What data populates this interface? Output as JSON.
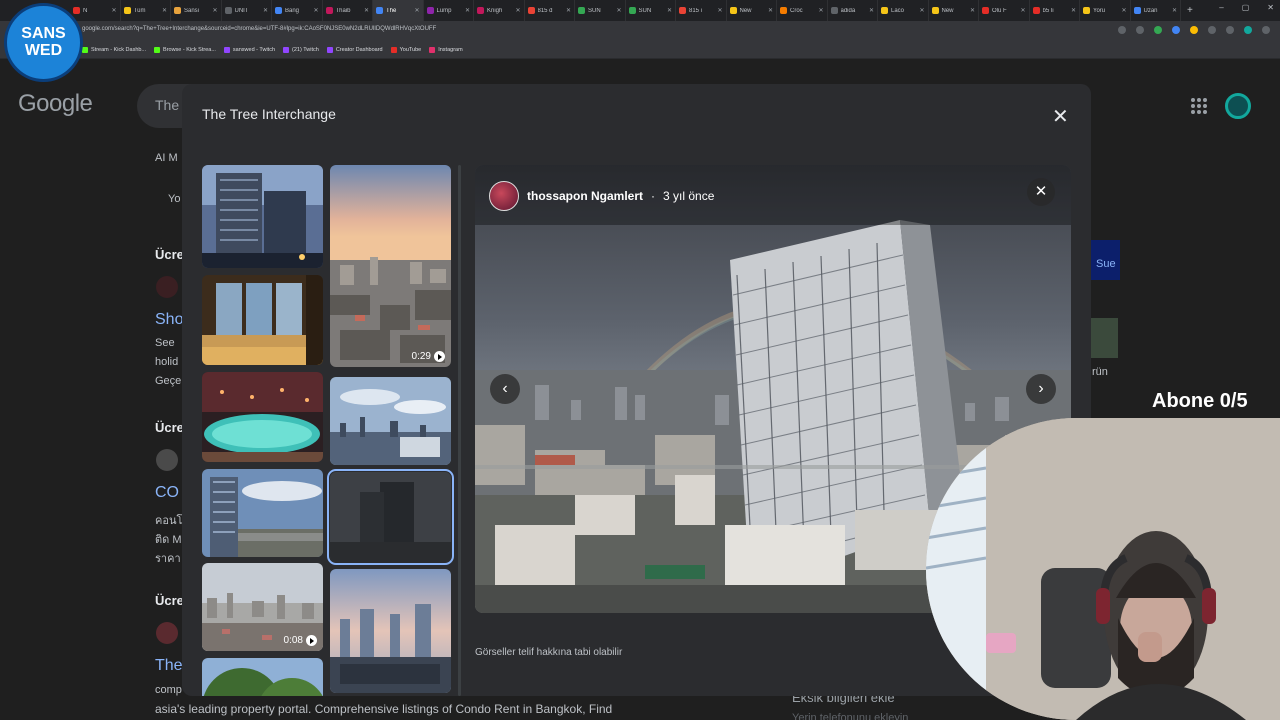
{
  "browser": {
    "tabs": [
      {
        "label": "N",
        "color": "#e52d27"
      },
      {
        "label": "Tüm",
        "color": "#f5c518"
      },
      {
        "label": "Sansi",
        "color": "#e8a33d"
      },
      {
        "label": "UNIT",
        "color": "#5f6368"
      },
      {
        "label": "Bang",
        "color": "#4285f4"
      },
      {
        "label": "Thaib",
        "color": "#c2185b"
      },
      {
        "label": "The",
        "color": "#4285f4",
        "active": true
      },
      {
        "label": "Lump",
        "color": "#8e24aa"
      },
      {
        "label": "Knigh",
        "color": "#c2185b"
      },
      {
        "label": "815 d",
        "color": "#ea4335"
      },
      {
        "label": "SUN",
        "color": "#34a853"
      },
      {
        "label": "SUN",
        "color": "#34a853"
      },
      {
        "label": "815 i",
        "color": "#ea4335"
      },
      {
        "label": "New",
        "color": "#f5c518"
      },
      {
        "label": "Croc",
        "color": "#f57c00"
      },
      {
        "label": "adida",
        "color": "#5f6368"
      },
      {
        "label": "Laco",
        "color": "#f5c518"
      },
      {
        "label": "New",
        "color": "#f5c518"
      },
      {
        "label": "Ölü F",
        "color": "#e52d27"
      },
      {
        "label": "b5 lı",
        "color": "#e52d27"
      },
      {
        "label": "Yoru",
        "color": "#f5c518"
      },
      {
        "label": "Uzan",
        "color": "#4285f4"
      }
    ],
    "new_tab": "+",
    "window_controls": [
      "–",
      "▢",
      "✕"
    ],
    "url": "google.com/search?q=The+Tree+Interchange&sourceid=chrome&ie=UTF-8#lpg=ik:CAoSF0NJSE0wN2dLRUlIDQWdlRHVqcXtOUFF",
    "bookmarks": [
      {
        "label": "Stream - Kick Dashb...",
        "color": "#53fc18"
      },
      {
        "label": "Browse - Kick Strea...",
        "color": "#53fc18"
      },
      {
        "label": "sanswed - Twitch",
        "color": "#9146ff"
      },
      {
        "label": "(21) Twitch",
        "color": "#9146ff"
      },
      {
        "label": "Creator Dashboard",
        "color": "#9146ff"
      },
      {
        "label": "YouTube",
        "color": "#e52d27"
      },
      {
        "label": "Instagram",
        "color": "#e1306c"
      }
    ]
  },
  "google": {
    "logo": "Google",
    "search_partial": "The",
    "left_texts": {
      "ai_mode": "AI M",
      "yo": "Yo",
      "ucre1": "Ücre",
      "sho": "Sho",
      "see": "See",
      "holid": "holid",
      "gec": "Geçe",
      "ucre2": "Ücre",
      "co": "CO",
      "thai1": "คอนโ",
      "thai2": "ติด M",
      "thai3": "ราคา",
      "ucre3": "Ücre",
      "the": "The",
      "comp": "comp"
    },
    "bottom_text": "asia's leading property portal. Comprehensive listings of Condo Rent in Bangkok, Find",
    "right_texts": {
      "sue": "Sue",
      "run": "rün",
      "eksik": "Eksik bilgileri ekle",
      "yerin": "Yerin telefonunu ekleyin"
    }
  },
  "modal": {
    "title": "The Tree Interchange",
    "close_icon": "close-icon",
    "thumbnails": [
      {
        "kind": "building-night"
      },
      {
        "kind": "city-sunset",
        "duration": "0:29"
      },
      {
        "kind": "room-window"
      },
      {
        "kind": "pool-night"
      },
      {
        "kind": "skyline-day"
      },
      {
        "kind": "tower-river"
      },
      {
        "kind": "tower-dusk",
        "selected": true
      },
      {
        "kind": "city-haze",
        "duration": "0:08"
      },
      {
        "kind": "rooftop-view"
      },
      {
        "kind": "tree"
      }
    ],
    "viewer": {
      "author": "thossapon Ngamlert",
      "separator": "·",
      "time_ago": "3 yıl önce",
      "prev_icon": "chevron-left-icon",
      "next_icon": "chevron-right-icon",
      "close_icon": "close-icon"
    },
    "copyright": "Görseller telif hakkına tabi olabilir"
  },
  "overlay": {
    "logo_line1": "SANS",
    "logo_line2": "WED",
    "subscriber_goal": "Abone 0/5"
  }
}
